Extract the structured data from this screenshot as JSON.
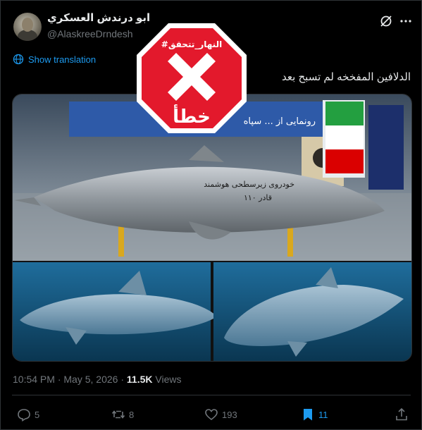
{
  "user": {
    "display_name": "ابو درندش العسكري",
    "handle": "@AlaskreeDrndesh"
  },
  "tweet": {
    "show_translation": "Show translation",
    "text": "الدلافين المفخخه لم تسبح  بعد",
    "time": "10:54 PM",
    "date": "May 5, 2026",
    "views_count": "11.5K",
    "views_label": "Views"
  },
  "stamp": {
    "tag": "#النهار_تتحقق",
    "verdict": "خطأ",
    "color": "#e3192c"
  },
  "media": {
    "banner_text": "رونمایی از ... سپاه",
    "body_text_1": "خودروی زیرسطحی هوشمند",
    "body_text_2": "قادر ۱۱۰"
  },
  "actions": {
    "replies": "5",
    "reposts": "8",
    "likes": "193",
    "bookmarks": "11"
  },
  "colors": {
    "accent": "#1d9bf0",
    "muted": "#71767b",
    "text": "#e7e9ea",
    "border": "#2f3336"
  }
}
